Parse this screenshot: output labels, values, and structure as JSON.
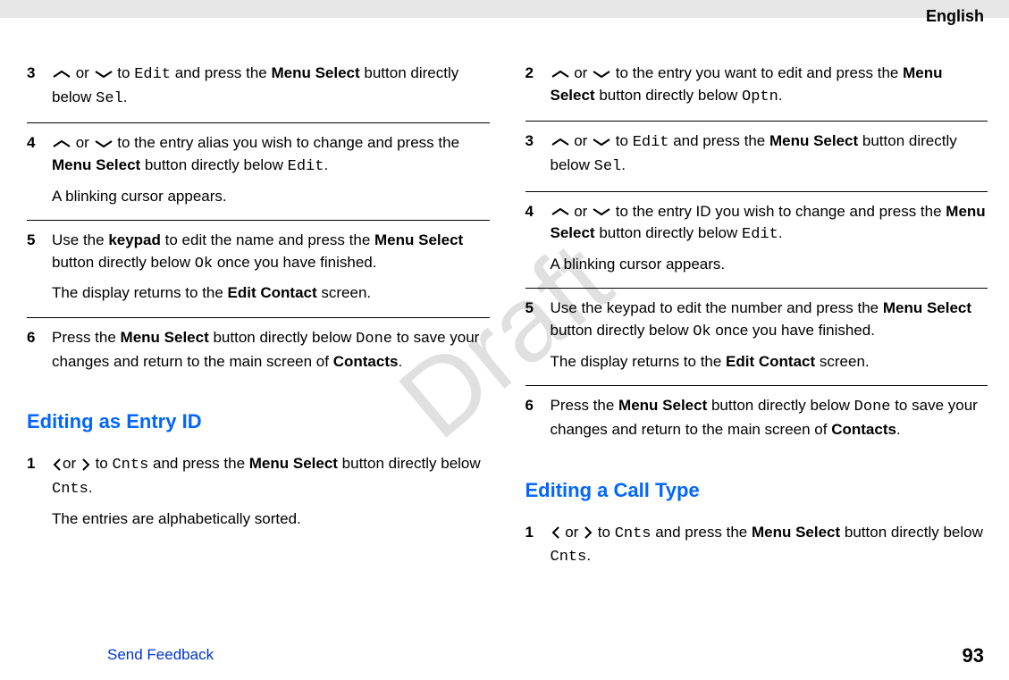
{
  "lang": "English",
  "watermark": "Draft",
  "footer": {
    "send": "Send Feedback",
    "page": "93"
  },
  "headings": {
    "entryId": "Editing as Entry ID",
    "callType": "Editing a Call Type"
  },
  "left": {
    "s3": {
      "t1": " or ",
      "t2": " to ",
      "edit": "Edit",
      "t3": " and press the ",
      "ms": "Menu Select",
      "t4": " button directly below ",
      "sel": "Sel",
      "t5": "."
    },
    "s4": {
      "t1": " or ",
      "t2": " to the entry alias you wish to change and press the ",
      "ms": "Menu Select",
      "t3": " button directly below ",
      "edit": "Edit",
      "t4": ".",
      "p2": "A blinking cursor appears."
    },
    "s5": {
      "t1": "Use the ",
      "kp": "keypad",
      "t2": " to edit the name and press the ",
      "ms": "Menu Select",
      "t3": " button directly below ",
      "ok": "Ok",
      "t4": " once you have finished.",
      "p2a": "The display returns to the ",
      "ec": "Edit Contact",
      "p2b": " screen."
    },
    "s6": {
      "t1": "Press the ",
      "ms": "Menu Select",
      "t2": " button directly below ",
      "done": "Done",
      "t3": " to save your changes and return to the main screen of ",
      "ct": "Contacts",
      "t4": "."
    },
    "e1": {
      "t1": "or ",
      "t2": " to ",
      "c1": "Cnts",
      "t3": " and press the ",
      "ms": "Menu Select",
      "t4": " button directly below ",
      "c2": "Cnts",
      "t5": ".",
      "p2": "The entries are alphabetically sorted."
    }
  },
  "right": {
    "s2": {
      "t1": " or ",
      "t2": " to the entry you want to edit and press the ",
      "ms": "Menu Select",
      "t3": " button directly below ",
      "optn": "Optn",
      "t4": "."
    },
    "s3": {
      "t1": " or ",
      "t2": " to ",
      "edit": "Edit",
      "t3": " and press the ",
      "ms": "Menu Select",
      "t4": " button directly below ",
      "sel": "Sel",
      "t5": "."
    },
    "s4": {
      "t1": " or ",
      "t2": " to the entry ID you wish to change and press the ",
      "ms": "Menu Select",
      "t3": " button directly below ",
      "edit": "Edit",
      "t4": ".",
      "p2": "A blinking cursor appears."
    },
    "s5": {
      "t1": "Use the keypad to edit the number and press the ",
      "ms": "Menu Select",
      "t2": " button directly below ",
      "ok": "Ok",
      "t3": " once you have finished.",
      "p2a": "The display returns to the ",
      "ec": "Edit Contact",
      "p2b": " screen."
    },
    "s6": {
      "t1": "Press the ",
      "ms": "Menu Select",
      "t2": " button directly below ",
      "done": "Done",
      "t3": " to save your changes and return to the main screen of ",
      "ct": "Contacts",
      "t4": "."
    },
    "c1": {
      "t1": " or ",
      "t2": " to ",
      "c1": "Cnts",
      "t3": " and press the ",
      "ms": "Menu Select",
      "t4": " button directly below ",
      "c2": "Cnts",
      "t5": "."
    }
  },
  "nums": {
    "n1": "1",
    "n2": "2",
    "n3": "3",
    "n4": "4",
    "n5": "5",
    "n6": "6"
  }
}
